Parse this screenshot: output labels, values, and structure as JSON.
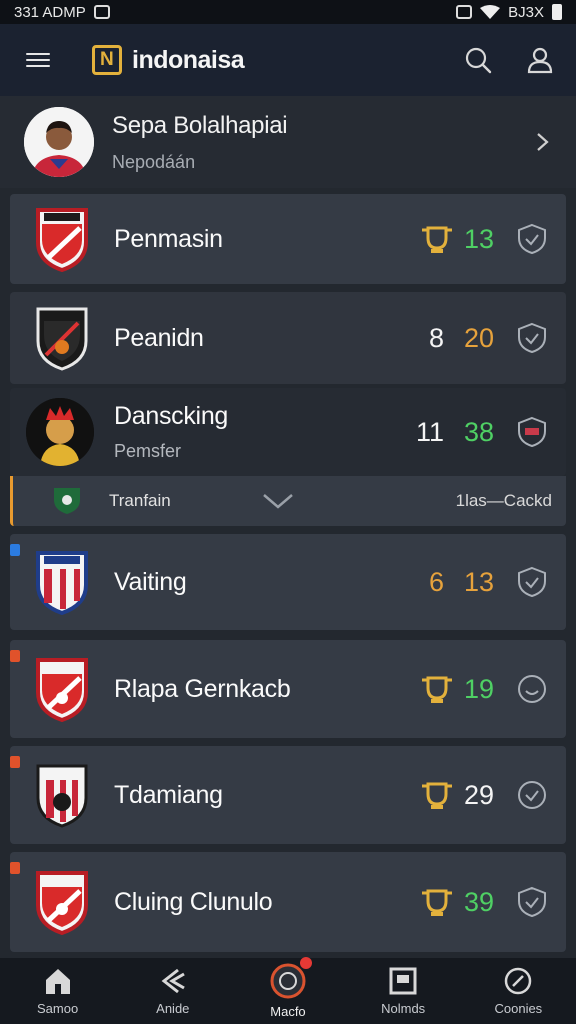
{
  "status_bar": {
    "time": "331 ADMP",
    "right_text": "BJ3X"
  },
  "app": {
    "title": "indonaisa"
  },
  "profile": {
    "name": "Sepa Bolalhapiai",
    "subtitle": "Nepodáán"
  },
  "teams": [
    {
      "name": "Penmasin",
      "stat1": "",
      "stat2": "13",
      "stat2_color": "green",
      "tag": ""
    },
    {
      "name": "Peanidn",
      "stat1": "8",
      "stat2": "20",
      "stat2_color": "orange",
      "tag": ""
    },
    {
      "name": "Danscking",
      "subtitle": "Pemsfer",
      "stat1": "11",
      "stat2": "38",
      "stat2_color": "green",
      "tag": ""
    },
    {
      "name": "Vaiting",
      "stat1": "6",
      "stat2": "13",
      "stat2_color": "orange",
      "tag": "0"
    },
    {
      "name": "Rlapa Gernkacb",
      "stat1": "",
      "stat2": "19",
      "stat2_color": "green",
      "tag": ""
    },
    {
      "name": "Tdamiang",
      "stat1": "",
      "stat2": "29",
      "stat2_color": "white",
      "tag": ""
    },
    {
      "name": "Cluing Clunulo",
      "stat1": "",
      "stat2": "39",
      "stat2_color": "green",
      "tag": ""
    }
  ],
  "subrow": {
    "left": "Tranfain",
    "right": "1las—Cackd"
  },
  "nav": [
    {
      "label": "Samoo"
    },
    {
      "label": "Anide"
    },
    {
      "label": "Macfo"
    },
    {
      "label": "Nolmds"
    },
    {
      "label": "Coonies"
    }
  ],
  "colors": {
    "accent": "#e3b13c",
    "green": "#4fd064",
    "orange": "#e6a23c",
    "card": "#353b45"
  }
}
